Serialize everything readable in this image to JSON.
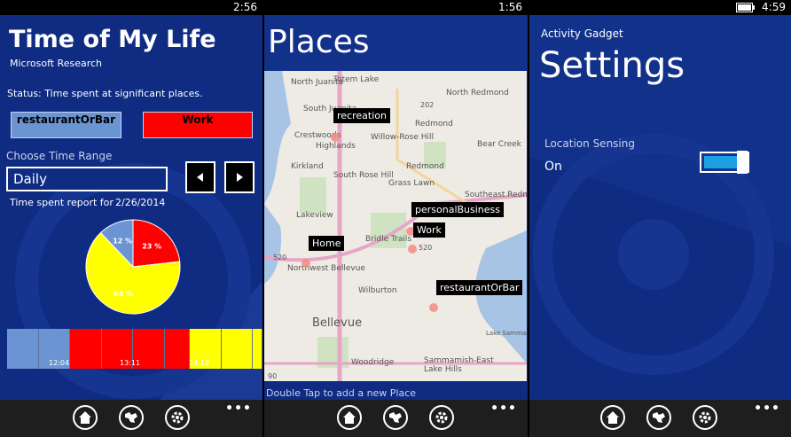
{
  "screen1": {
    "clock": "2:56",
    "app_title": "Time of My Life",
    "app_subtitle": "Microsoft Research",
    "status": "Status: Time spent at significant places.",
    "legend": [
      {
        "label": "restaurantOrBar",
        "color": "#6b95d2"
      },
      {
        "label": "Work",
        "color": "#ff0000"
      }
    ],
    "range_label": "Choose Time Range",
    "range_value": "Daily",
    "report_label": "Time spent report for",
    "report_date": "2/26/2014",
    "chart_data": {
      "type": "pie",
      "slices": [
        {
          "label": "12 %",
          "value": 12,
          "color": "#6b95d2"
        },
        {
          "label": "23 %",
          "value": 23,
          "color": "#ff0000"
        },
        {
          "label": "64 %",
          "value": 64,
          "color": "#ffff00"
        }
      ]
    },
    "timeline": {
      "segments": [
        {
          "color": "#6b95d2",
          "weight": 1
        },
        {
          "color": "#6b95d2",
          "weight": 1
        },
        {
          "color": "#ff0000",
          "weight": 1
        },
        {
          "color": "#ff0000",
          "weight": 1
        },
        {
          "color": "#ff0000",
          "weight": 1
        },
        {
          "color": "#ff0000",
          "weight": 0.8
        },
        {
          "color": "#ffff00",
          "weight": 1
        },
        {
          "color": "#ffff00",
          "weight": 1
        },
        {
          "color": "#ffff00",
          "weight": 0.3
        }
      ],
      "ticks": [
        "12:04",
        "13:11",
        "14:19"
      ]
    },
    "dots": "•••"
  },
  "screen2": {
    "clock": "1:56",
    "title": "Places",
    "footer_hint": "Double Tap to add a new Place",
    "map_labels": [
      "North Juanita",
      "Totem Lake",
      "North Redmond",
      "South Juanita",
      "Redmond",
      "Crestwoods",
      "Highlands",
      "Willow-Rose Hill",
      "Bear Creek",
      "Kirkland",
      "South Rose Hill",
      "Redmond",
      "Grass Lawn",
      "Southeast Redmond",
      "Lakeview",
      "Bridle Trails",
      "Northwest Bellevue",
      "Bellevue",
      "Wilburton",
      "Woodridge",
      "Sammamish-East Lake Hills",
      "Lake Sammamish",
      "202",
      "520",
      "520",
      "90"
    ],
    "places": [
      {
        "label": "recreation"
      },
      {
        "label": "personalBusiness"
      },
      {
        "label": "Work"
      },
      {
        "label": "Home"
      },
      {
        "label": "restaurantOrBar"
      }
    ],
    "dots": "•••"
  },
  "screen3": {
    "clock": "4:59",
    "app_name": "Activity Gadget",
    "title": "Settings",
    "setting_label": "Location Sensing",
    "setting_value": "On",
    "toggle_on": true,
    "dots": "•••"
  },
  "appbar_icons": [
    "home-icon",
    "world-map-icon",
    "gear-icon"
  ],
  "colors": {
    "screen_bg": "#0f2b82",
    "accent": "#1ba1e2",
    "appbar_bg": "#1e1e1e"
  }
}
